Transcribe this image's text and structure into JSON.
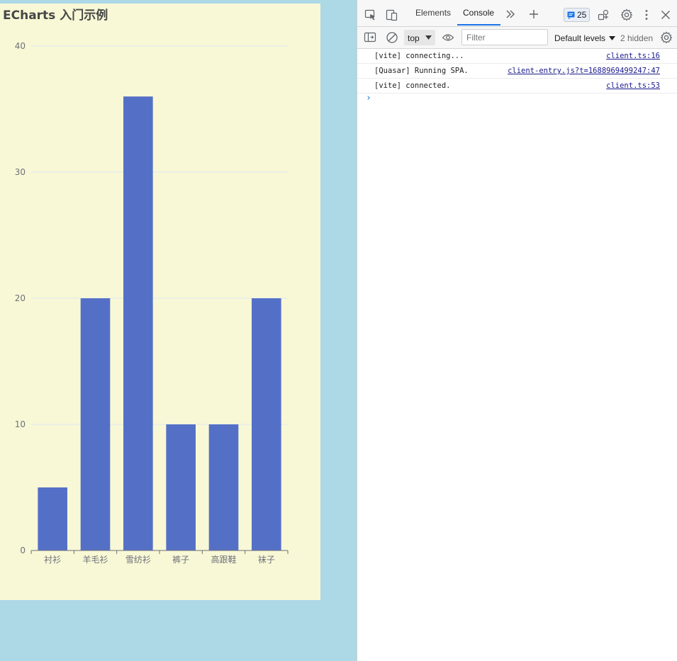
{
  "chart": {
    "title": "ECharts 入门示例"
  },
  "chart_data": {
    "type": "bar",
    "title": "ECharts 入门示例",
    "categories": [
      "衬衫",
      "羊毛衫",
      "雪纺衫",
      "裤子",
      "高跟鞋",
      "袜子"
    ],
    "values": [
      5,
      20,
      36,
      10,
      10,
      20
    ],
    "yticks": [
      "0",
      "10",
      "20",
      "30",
      "40"
    ],
    "ylim": [
      0,
      40
    ],
    "grid": true,
    "bar_color": "#5470c6",
    "xlabel": "",
    "ylabel": ""
  },
  "devtools": {
    "tabs": [
      {
        "label": "Elements"
      },
      {
        "label": "Console"
      }
    ],
    "issues_count": "25",
    "context": "top",
    "filter_placeholder": "Filter",
    "levels": "Default levels",
    "hidden": "2 hidden",
    "accent_color": "#1a73e8",
    "logs": [
      {
        "message": "[vite] connecting...",
        "source": "client.ts:16"
      },
      {
        "message": "[Quasar] Running SPA.",
        "source": "client-entry.js?t=1688969499247:47"
      },
      {
        "message": "[vite] connected.",
        "source": "client.ts:53"
      }
    ],
    "prompt": "›"
  },
  "colors": {
    "page_background": "#add8e6",
    "chart_background": "#f8f8d6"
  }
}
